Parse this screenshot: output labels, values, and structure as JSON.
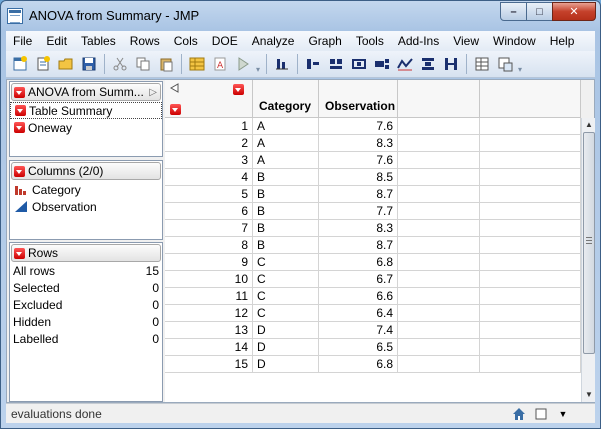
{
  "window": {
    "title": "ANOVA from Summary - JMP",
    "buttons": {
      "minimize": "–",
      "maximize": "□",
      "close": "✕"
    }
  },
  "menu": [
    "File",
    "Edit",
    "Tables",
    "Rows",
    "Cols",
    "DOE",
    "Analyze",
    "Graph",
    "Tools",
    "Add-Ins",
    "View",
    "Window",
    "Help"
  ],
  "left": {
    "table_panel": {
      "title": "ANOVA from Summ...",
      "items": [
        "Table Summary",
        "Oneway"
      ]
    },
    "columns_panel": {
      "title": "Columns (2/0)",
      "items": [
        {
          "label": "Category",
          "icon": "nominal-bar-icon"
        },
        {
          "label": "Observation",
          "icon": "continuous-triangle-icon"
        }
      ]
    },
    "rows_panel": {
      "title": "Rows",
      "items": [
        {
          "label": "All rows",
          "value": "15"
        },
        {
          "label": "Selected",
          "value": "0"
        },
        {
          "label": "Excluded",
          "value": "0"
        },
        {
          "label": "Hidden",
          "value": "0"
        },
        {
          "label": "Labelled",
          "value": "0"
        }
      ]
    }
  },
  "grid": {
    "columns": [
      "Category",
      "Observation"
    ],
    "rows": [
      {
        "n": "1",
        "category": "A",
        "observation": "7.6"
      },
      {
        "n": "2",
        "category": "A",
        "observation": "8.3"
      },
      {
        "n": "3",
        "category": "A",
        "observation": "7.6"
      },
      {
        "n": "4",
        "category": "B",
        "observation": "8.5"
      },
      {
        "n": "5",
        "category": "B",
        "observation": "8.7"
      },
      {
        "n": "6",
        "category": "B",
        "observation": "7.7"
      },
      {
        "n": "7",
        "category": "B",
        "observation": "8.3"
      },
      {
        "n": "8",
        "category": "B",
        "observation": "8.7"
      },
      {
        "n": "9",
        "category": "C",
        "observation": "6.8"
      },
      {
        "n": "10",
        "category": "C",
        "observation": "6.7"
      },
      {
        "n": "11",
        "category": "C",
        "observation": "6.6"
      },
      {
        "n": "12",
        "category": "C",
        "observation": "6.4"
      },
      {
        "n": "13",
        "category": "D",
        "observation": "7.4"
      },
      {
        "n": "14",
        "category": "D",
        "observation": "6.5"
      },
      {
        "n": "15",
        "category": "D",
        "observation": "6.8"
      }
    ]
  },
  "status": {
    "text": "evaluations done"
  },
  "colors": {
    "red_triangle": "#cc0000",
    "titlebar": "#a9c4e4",
    "accent": "#3a6ea5"
  }
}
